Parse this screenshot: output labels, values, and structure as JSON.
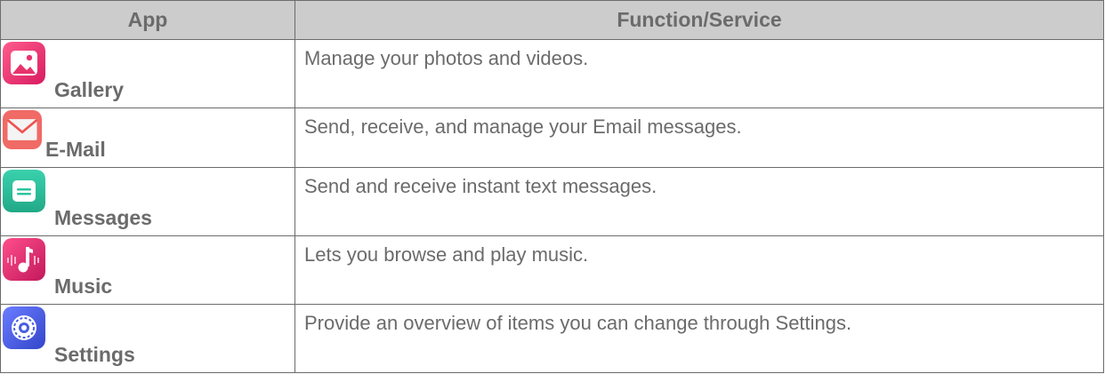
{
  "table": {
    "headers": {
      "app": "App",
      "function": "Function/Service"
    },
    "rows": [
      {
        "app_name": "Gallery",
        "icon": "gallery-icon",
        "function": "Manage your photos and videos."
      },
      {
        "app_name": "E-Mail",
        "icon": "email-icon",
        "function": "Send, receive, and manage your Email messages."
      },
      {
        "app_name": "Messages",
        "icon": "messages-icon",
        "function": "Send and receive instant text messages."
      },
      {
        "app_name": "Music",
        "icon": "music-icon",
        "function": "Lets you browse and play music."
      },
      {
        "app_name": "Settings",
        "icon": "settings-icon",
        "function": "Provide an overview of items you can change through Settings."
      }
    ]
  },
  "colors": {
    "header_bg": "#cccccc",
    "text": "#6b6b6b",
    "border": "#6b6b6b",
    "gallery": "#e8336d",
    "email": "#ef5350",
    "messages": "#2ec4a0",
    "music": "#e5336f",
    "settings": "#4a5fe0"
  }
}
